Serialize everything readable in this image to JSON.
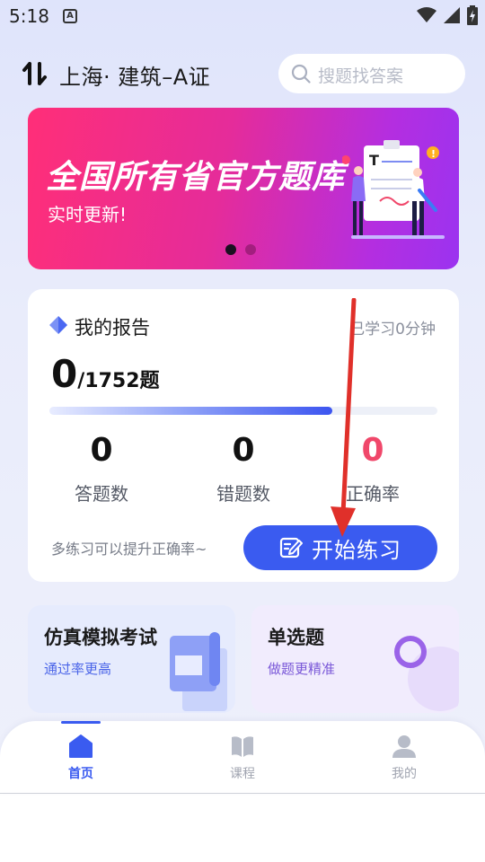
{
  "status_bar": {
    "time": "5:18",
    "notification_icon": "A"
  },
  "header": {
    "location": "上海· 建筑–A证",
    "search_placeholder": "搜题找答案"
  },
  "banner": {
    "title": "全国所有省官方题库",
    "subtitle": "实时更新!",
    "slide_count": 2,
    "active_slide": 1
  },
  "report": {
    "title": "我的报告",
    "study_time": "已学习0分钟",
    "done": "0",
    "total": "/1752题",
    "progress_fraction": 0.73,
    "stats": [
      {
        "value": "0",
        "label": "答题数"
      },
      {
        "value": "0",
        "label": "错题数"
      },
      {
        "value": "0",
        "label": "正确率"
      }
    ],
    "tip": "多练习可以提升正确率~",
    "start_button": "开始练习"
  },
  "cards": [
    {
      "title": "仿真模拟考试",
      "subtitle": "通过率更高"
    },
    {
      "title": "单选题",
      "subtitle": "做题更精准"
    }
  ],
  "nav": [
    {
      "label": "首页",
      "icon": "home-icon",
      "active": true
    },
    {
      "label": "课程",
      "icon": "book-icon",
      "active": false
    },
    {
      "label": "我的",
      "icon": "user-icon",
      "active": false
    }
  ],
  "colors": {
    "accent": "#3a5bf0",
    "danger": "#f0476a",
    "annotation_arrow": "#e0302a"
  }
}
